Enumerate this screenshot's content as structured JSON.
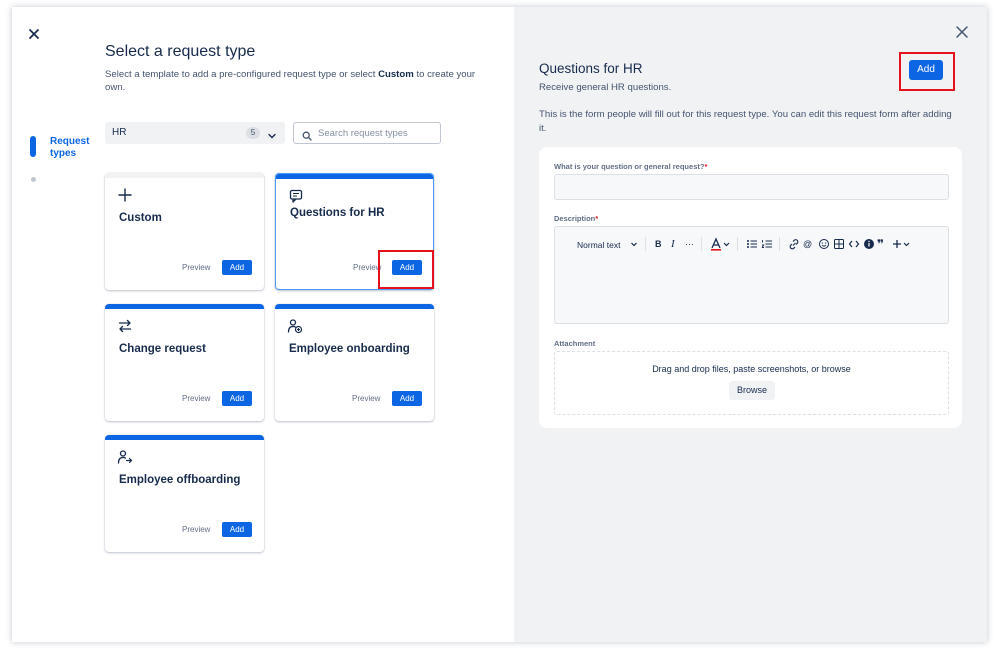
{
  "left": {
    "title": "Select a request type",
    "subtitle_before": "Select a template to add a pre-configured request type or select ",
    "subtitle_bold": "Custom",
    "subtitle_after": " to create your own.",
    "step_label": "Request types",
    "category": {
      "value": "HR",
      "count": "5"
    },
    "search": {
      "placeholder": "Search request types",
      "value": ""
    },
    "cards": [
      {
        "title": "Custom",
        "icon": "plus-icon",
        "preview": "Preview",
        "add": "Add"
      },
      {
        "title": "Questions for HR",
        "icon": "chat-icon",
        "preview": "Preview",
        "add": "Add"
      },
      {
        "title": "Change request",
        "icon": "swap-arrows-icon",
        "preview": "Preview",
        "add": "Add"
      },
      {
        "title": "Employee onboarding",
        "icon": "person-add-icon",
        "preview": "Preview",
        "add": "Add"
      },
      {
        "title": "Employee offboarding",
        "icon": "person-leave-icon",
        "preview": "Preview",
        "add": "Add"
      }
    ]
  },
  "right": {
    "title": "Questions for HR",
    "subtitle": "Receive general HR questions.",
    "add_label": "Add",
    "description": "This is the form people will fill out for this request type. You can edit this request form after adding it.",
    "form": {
      "question_label": "What is your question or general request?",
      "description_label": "Description",
      "required_mark": "*",
      "text_style": "Normal text",
      "attachment_label": "Attachment",
      "dropzone_text": "Drag and drop files, paste screenshots, or browse",
      "browse_label": "Browse"
    }
  },
  "colors": {
    "primary": "#0c66e4",
    "highlight": "#e5121d",
    "right_bg": "#f1f2f4"
  }
}
